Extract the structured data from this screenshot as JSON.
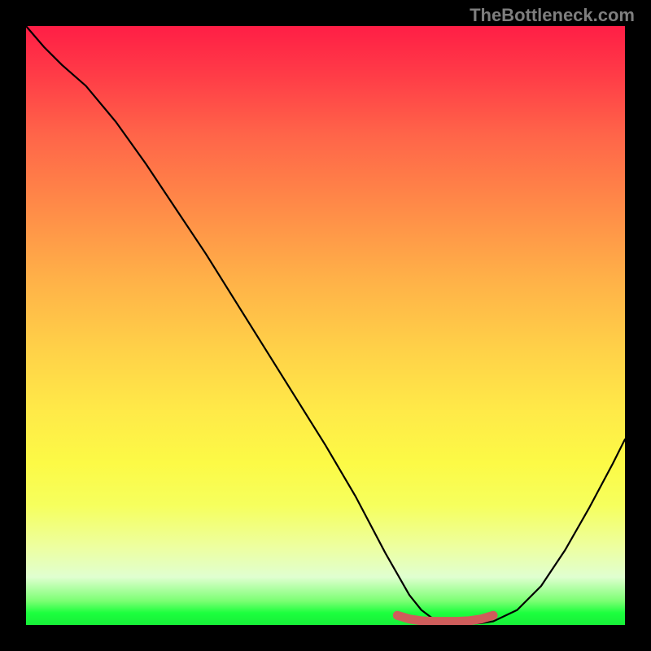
{
  "watermark": "TheBottleneck.com",
  "chart_data": {
    "type": "line",
    "title": "",
    "xlabel": "",
    "ylabel": "",
    "xlim": [
      0,
      100
    ],
    "ylim": [
      0,
      100
    ],
    "series": [
      {
        "name": "curve",
        "x": [
          0,
          3,
          6,
          10,
          15,
          20,
          25,
          30,
          35,
          40,
          45,
          50,
          55,
          60,
          62,
          64,
          66,
          68,
          70,
          72,
          74,
          76,
          78,
          82,
          86,
          90,
          94,
          98,
          100
        ],
        "y": [
          100,
          96.5,
          93.5,
          90,
          84,
          77,
          69.5,
          62,
          54,
          46,
          38,
          30,
          21.5,
          12,
          8.5,
          5,
          2.5,
          1,
          0.4,
          0.2,
          0.2,
          0.3,
          0.6,
          2.5,
          6.5,
          12.5,
          19.5,
          27,
          31
        ]
      },
      {
        "name": "marker-band",
        "x": [
          62,
          64,
          66,
          68,
          70,
          72,
          74,
          76,
          78
        ],
        "y": [
          1.6,
          1.0,
          0.7,
          0.6,
          0.6,
          0.6,
          0.7,
          1.0,
          1.6
        ]
      }
    ],
    "annotations": []
  },
  "colors": {
    "curve": "#000000",
    "marker": "#cf5d5b",
    "background_frame": "#000000"
  }
}
